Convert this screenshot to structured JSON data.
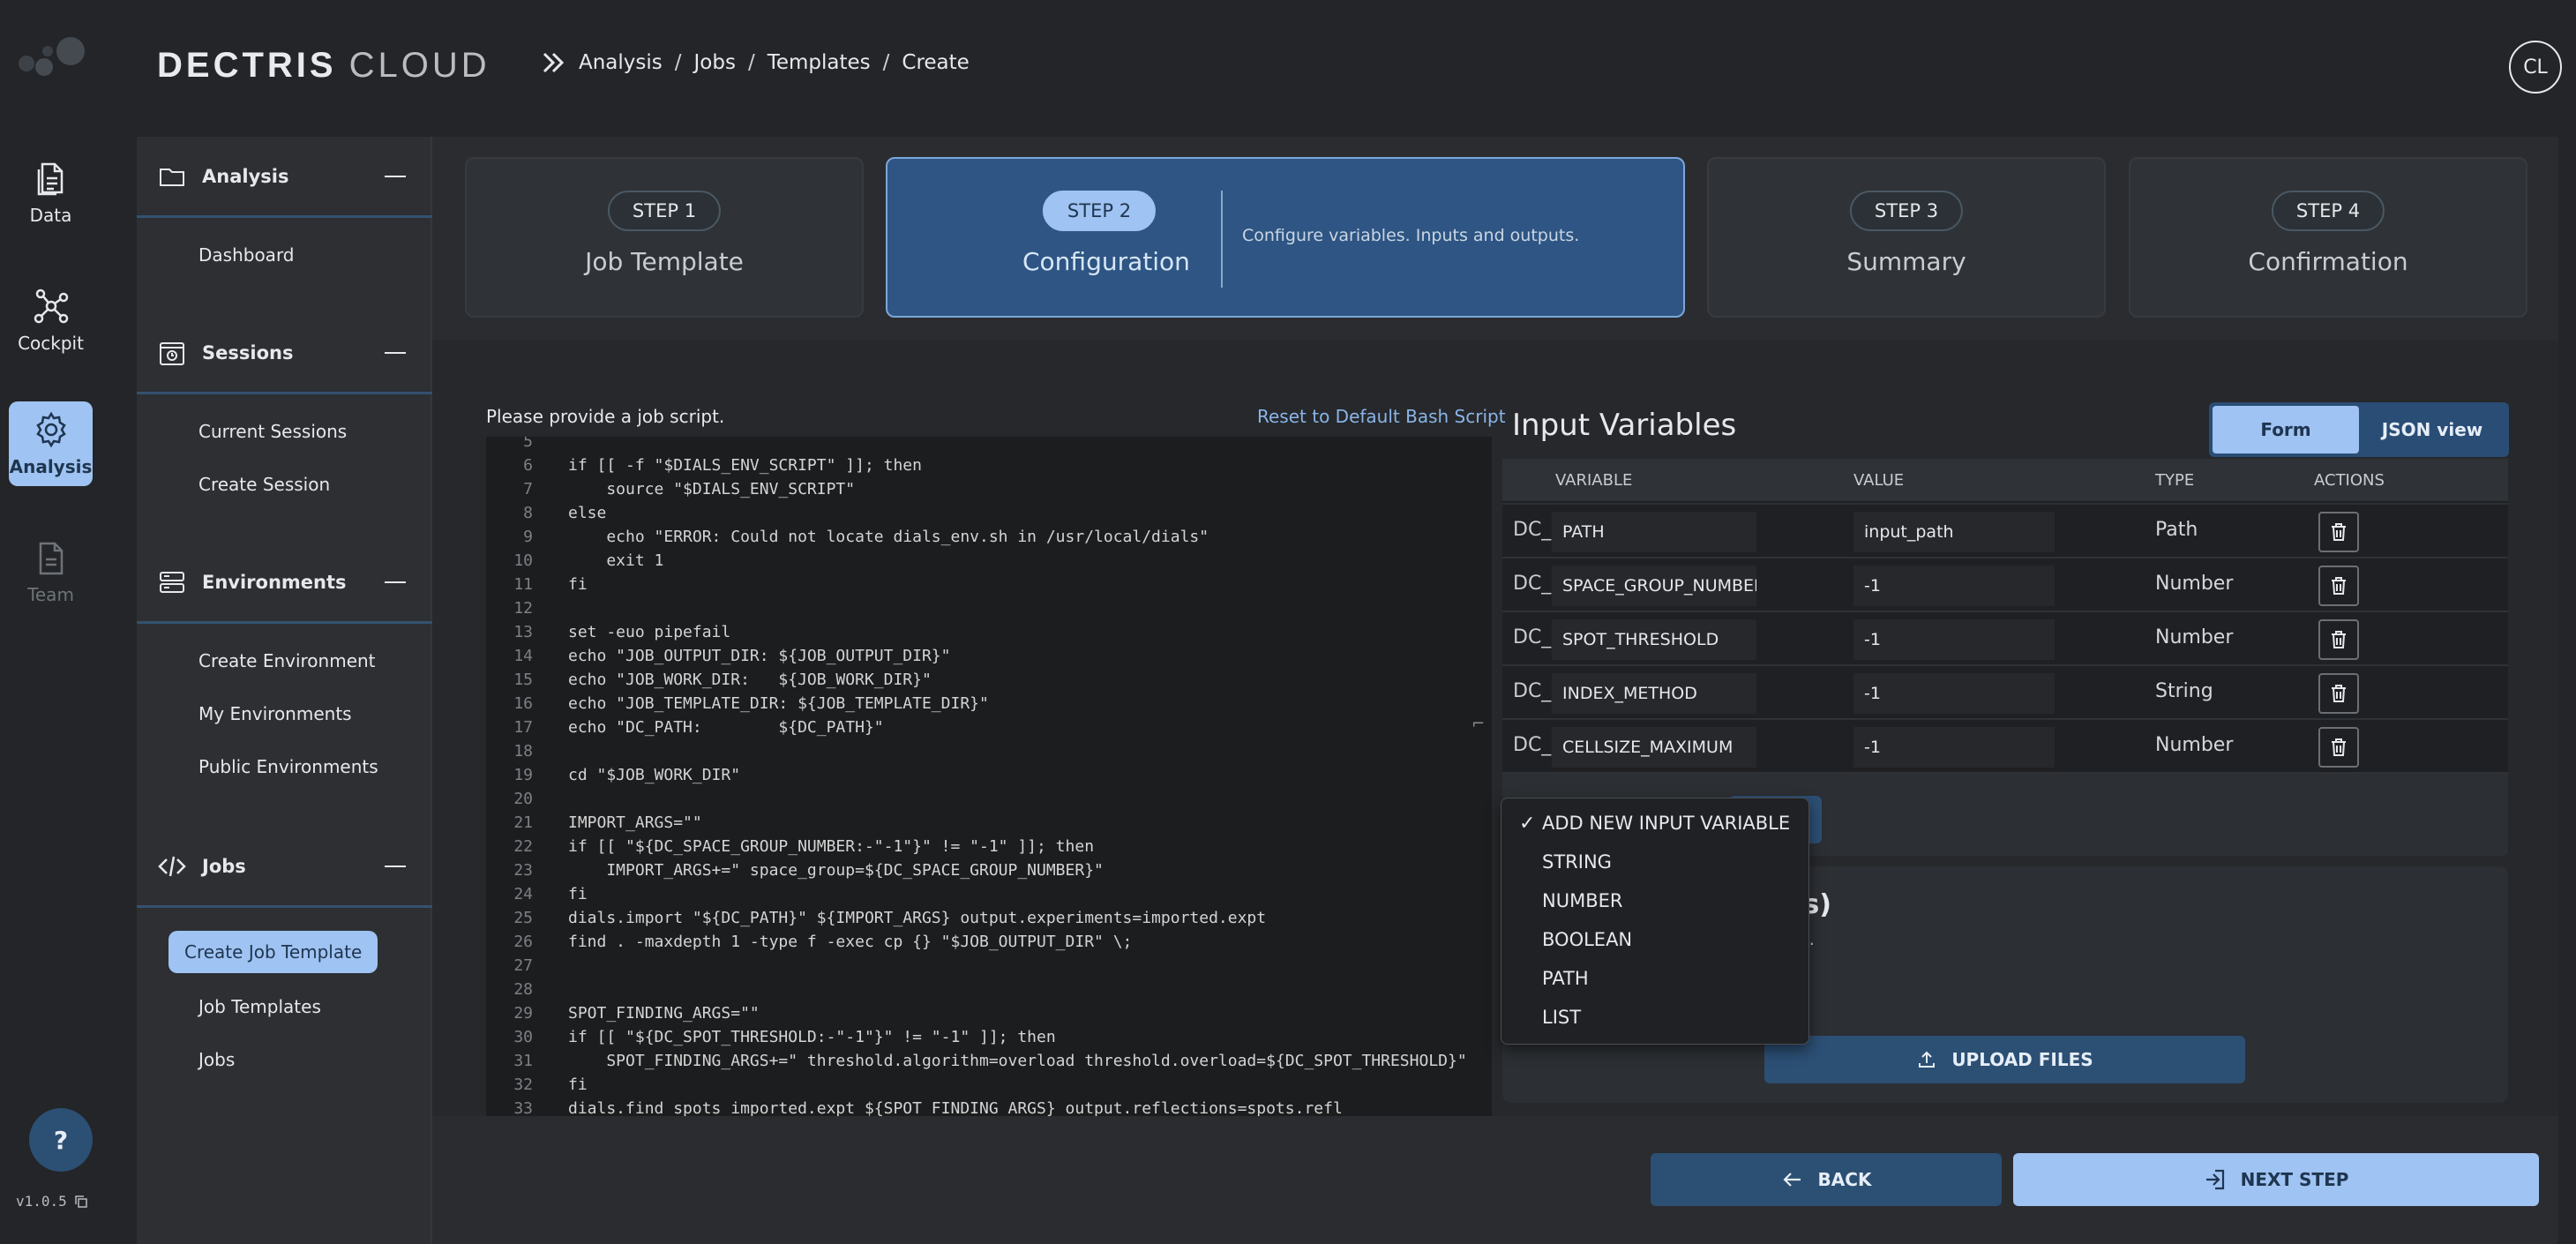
{
  "brand": {
    "name_bold": "DECTRIS",
    "name_light": "CLOUD"
  },
  "breadcrumb": [
    "Analysis",
    "Jobs",
    "Templates",
    "Create"
  ],
  "user": {
    "initials": "CL"
  },
  "rail": {
    "items": [
      {
        "label": "Data",
        "icon": "document-icon"
      },
      {
        "label": "Cockpit",
        "icon": "network-icon"
      },
      {
        "label": "Analysis",
        "icon": "gear-icon"
      },
      {
        "label": "Team",
        "icon": "document-icon"
      }
    ],
    "help": "?",
    "version": "v1.0.5"
  },
  "sidebar": {
    "sections": [
      {
        "title": "Analysis",
        "icon": "folder-icon",
        "links": [
          "Dashboard"
        ]
      },
      {
        "title": "Sessions",
        "icon": "session-icon",
        "links": [
          "Current Sessions",
          "Create Session"
        ]
      },
      {
        "title": "Environments",
        "icon": "server-icon",
        "links": [
          "Create Environment",
          "My Environments",
          "Public Environments"
        ]
      },
      {
        "title": "Jobs",
        "icon": "code-icon",
        "links": [
          "Create Job Template",
          "Job Templates",
          "Jobs"
        ]
      }
    ],
    "active_link": "Create Job Template"
  },
  "steps": [
    {
      "pill": "STEP 1",
      "title": "Job Template"
    },
    {
      "pill": "STEP 2",
      "title": "Configuration",
      "description": "Configure variables. Inputs and outputs."
    },
    {
      "pill": "STEP 3",
      "title": "Summary"
    },
    {
      "pill": "STEP 4",
      "title": "Confirmation"
    }
  ],
  "script": {
    "label": "Please provide a job script.",
    "reset": "Reset to Default Bash Script",
    "lines": [
      {
        "n": "5",
        "t": ""
      },
      {
        "n": "6",
        "t": "if [[ -f \"$DIALS_ENV_SCRIPT\" ]]; then"
      },
      {
        "n": "7",
        "t": "    source \"$DIALS_ENV_SCRIPT\""
      },
      {
        "n": "8",
        "t": "else"
      },
      {
        "n": "9",
        "t": "    echo \"ERROR: Could not locate dials_env.sh in /usr/local/dials\""
      },
      {
        "n": "10",
        "t": "    exit 1"
      },
      {
        "n": "11",
        "t": "fi"
      },
      {
        "n": "12",
        "t": ""
      },
      {
        "n": "13",
        "t": "set -euo pipefail"
      },
      {
        "n": "14",
        "t": "echo \"JOB_OUTPUT_DIR: ${JOB_OUTPUT_DIR}\""
      },
      {
        "n": "15",
        "t": "echo \"JOB_WORK_DIR:   ${JOB_WORK_DIR}\""
      },
      {
        "n": "16",
        "t": "echo \"JOB_TEMPLATE_DIR: ${JOB_TEMPLATE_DIR}\""
      },
      {
        "n": "17",
        "t": "echo \"DC_PATH:        ${DC_PATH}\""
      },
      {
        "n": "18",
        "t": ""
      },
      {
        "n": "19",
        "t": "cd \"$JOB_WORK_DIR\""
      },
      {
        "n": "20",
        "t": ""
      },
      {
        "n": "21",
        "t": "IMPORT_ARGS=\"\""
      },
      {
        "n": "22",
        "t": "if [[ \"${DC_SPACE_GROUP_NUMBER:-\"-1\"}\" != \"-1\" ]]; then"
      },
      {
        "n": "23",
        "t": "    IMPORT_ARGS+=\" space_group=${DC_SPACE_GROUP_NUMBER}\""
      },
      {
        "n": "24",
        "t": "fi"
      },
      {
        "n": "25",
        "t": "dials.import \"${DC_PATH}\" ${IMPORT_ARGS} output.experiments=imported.expt"
      },
      {
        "n": "26",
        "t": "find . -maxdepth 1 -type f -exec cp {} \"$JOB_OUTPUT_DIR\" \\;"
      },
      {
        "n": "27",
        "t": ""
      },
      {
        "n": "28",
        "t": ""
      },
      {
        "n": "29",
        "t": "SPOT_FINDING_ARGS=\"\""
      },
      {
        "n": "30",
        "t": "if [[ \"${DC_SPOT_THRESHOLD:-\"-1\"}\" != \"-1\" ]]; then"
      },
      {
        "n": "31",
        "t": "    SPOT_FINDING_ARGS+=\" threshold.algorithm=overload threshold.overload=${DC_SPOT_THRESHOLD}\""
      },
      {
        "n": "32",
        "t": "fi"
      },
      {
        "n": "33",
        "t": "dials.find_spots imported.expt ${SPOT_FINDING_ARGS} output.reflections=spots.refl"
      }
    ]
  },
  "variables": {
    "title": "Input Variables",
    "view_toggle": {
      "form": "Form",
      "json": "JSON view"
    },
    "columns": [
      "VARIABLE",
      "VALUE",
      "TYPE",
      "ACTIONS"
    ],
    "prefix": "DC_",
    "rows": [
      {
        "name": "PATH",
        "value": "input_path",
        "type": "Path"
      },
      {
        "name": "SPACE_GROUP_NUMBER",
        "value": "-1",
        "type": "Number"
      },
      {
        "name": "SPOT_THRESHOLD",
        "value": "-1",
        "type": "Number"
      },
      {
        "name": "INDEX_METHOD",
        "value": "-1",
        "type": "String"
      },
      {
        "name": "CELLSIZE_MAXIMUM",
        "value": "-1",
        "type": "Number"
      }
    ]
  },
  "dropdown": {
    "items": [
      "ADD NEW INPUT VARIABLE",
      "STRING",
      "NUMBER",
      "BOOLEAN",
      "PATH",
      "LIST"
    ],
    "checked": "ADD NEW INPUT VARIABLE"
  },
  "upload": {
    "title_visible": "le(s)",
    "subtitle_visible": "ere.",
    "button": "UPLOAD FILES"
  },
  "footer": {
    "back": "BACK",
    "next": "NEXT STEP"
  },
  "colors": {
    "accent": "#9fc3f2",
    "accent_dark": "#2c4f74",
    "active_step": "#2e5583",
    "background": "#232528"
  }
}
